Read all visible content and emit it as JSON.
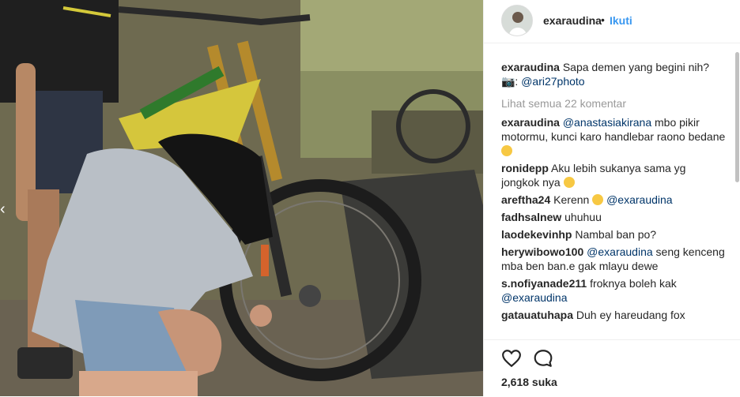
{
  "post": {
    "username": "exaraudina",
    "dot": "•",
    "follow_label": "Ikuti"
  },
  "caption": {
    "username": "exaraudina",
    "text": "Sapa demen yang begini nih?",
    "camera_glyph": "📷:",
    "credit": "@ari27photo"
  },
  "view_all": "Lihat semua 22 komentar",
  "comments": [
    {
      "user": "exaraudina",
      "mention": "@anastasiakirana",
      "text": "mbo pikir motormu, kunci karo handlebar raono bedane",
      "emoji": "laughing-face-icon"
    },
    {
      "user": "ronidepp",
      "text": "Aku lebih sukanya sama yg jongkok nya",
      "emoji": "laughing-face-icon"
    },
    {
      "user": "areftha24",
      "text": "Kerenn",
      "emoji": "scared-face-icon",
      "mention": "@exaraudina"
    },
    {
      "user": "fadhsalnew",
      "text": "uhuhuu"
    },
    {
      "user": "laodekevinhp",
      "text": "Nambal ban po?"
    },
    {
      "user": "herywibowo100",
      "mention": "@exaraudina",
      "text": "seng kenceng mba ben ban.e gak mlayu dewe"
    },
    {
      "user": "s.nofiyanade211",
      "text": "froknya boleh kak",
      "mention": "@exaraudina"
    },
    {
      "user": "gatauatuhapa",
      "text": "Duh ey hareudang fox"
    }
  ],
  "likes": "2,618 suka",
  "colors": {
    "link": "#003569",
    "follow": "#3897f0",
    "muted": "#999999",
    "text": "#262626"
  },
  "icons": {
    "like": "heart-icon",
    "comment": "speech-bubble-icon"
  }
}
